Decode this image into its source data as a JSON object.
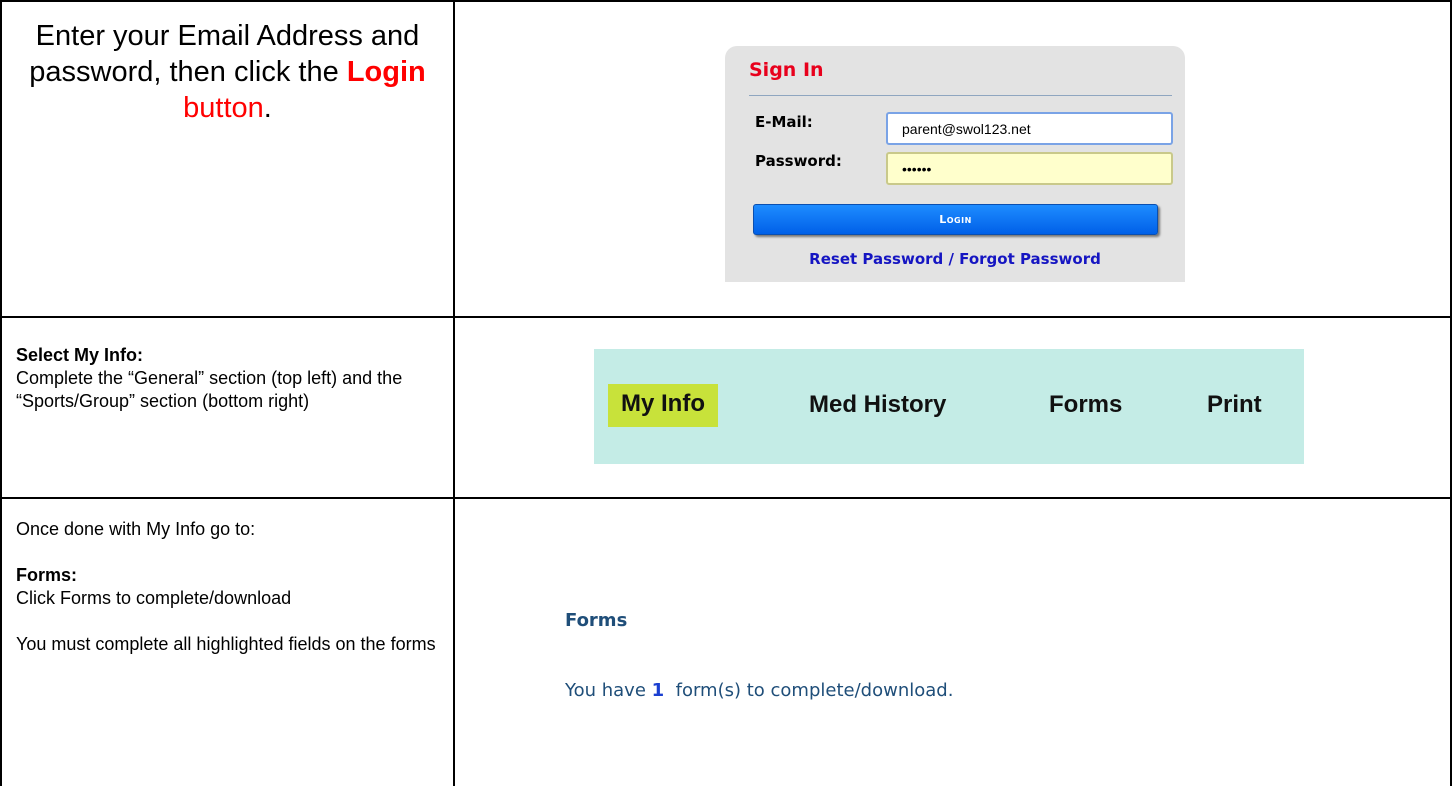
{
  "row1": {
    "instruction_part1": "Enter your Email Address and password, then click the ",
    "instruction_login": "Login",
    "instruction_button": "button",
    "instruction_end": ".",
    "signin": {
      "title": "Sign In",
      "email_label": "E-Mail:",
      "email_value": "parent@swol123.net",
      "password_label": "Password:",
      "password_value": "••••••",
      "login_button": "Login",
      "reset_link": "Reset Password / Forgot Password"
    }
  },
  "row2": {
    "heading": "Select My Info:",
    "body": "Complete the “General” section (top left) and the “Sports/Group” section (bottom right)",
    "nav": {
      "my_info": "My Info",
      "med_history": "Med History",
      "forms": "Forms",
      "print": "Print"
    },
    "colors": {
      "nav_bg": "#c4ece6",
      "active_highlight": "#c8e23a"
    }
  },
  "row3": {
    "intro": "Once done with My Info go to:",
    "heading": "Forms:",
    "body1": "Click Forms to complete/download",
    "body2": "You must complete all highlighted fields on the forms",
    "panel_title": "Forms",
    "msg_prefix": "You have ",
    "msg_count": "1",
    "msg_suffix": "  form(s) to complete/download."
  }
}
